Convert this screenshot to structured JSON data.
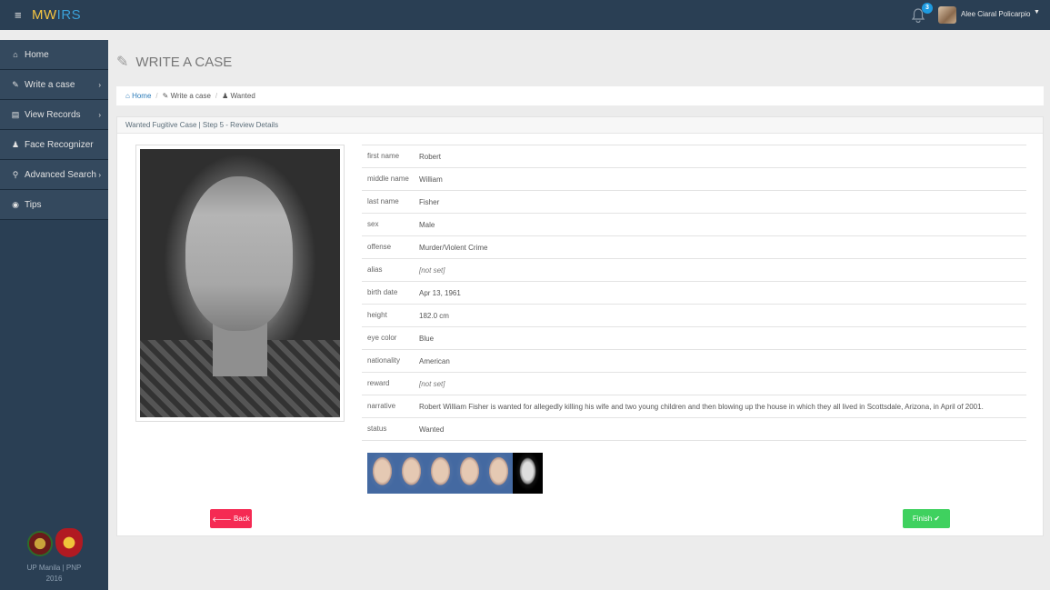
{
  "app": {
    "brand_part1": "MW",
    "brand_part2": "IRS",
    "menu_icon": "menu-icon"
  },
  "topbar": {
    "notifications_count": "3",
    "user_name": "Alee Ciaral Policarpio",
    "caret": "▼"
  },
  "sidebar": {
    "items": [
      {
        "label": "Home",
        "icon": "home-icon",
        "glyph": "⌂",
        "has_chevron": false
      },
      {
        "label": "Write a case",
        "icon": "edit-icon",
        "glyph": "✎",
        "has_chevron": true
      },
      {
        "label": "View Records",
        "icon": "list-icon",
        "glyph": "▤",
        "has_chevron": true
      },
      {
        "label": "Face Recognizer",
        "icon": "user-icon",
        "glyph": "♟",
        "has_chevron": false
      },
      {
        "label": "Advanced Search",
        "icon": "search-icon",
        "glyph": "⚲",
        "has_chevron": true
      },
      {
        "label": "Tips",
        "icon": "eye-icon",
        "glyph": "◉",
        "has_chevron": false
      }
    ],
    "footer_line1": "UP Manila | PNP",
    "footer_line2": "2016"
  },
  "page": {
    "title": "WRITE A CASE"
  },
  "breadcrumb": {
    "home": "Home",
    "write": "Write a case",
    "current": "Wanted"
  },
  "panel": {
    "heading": "Wanted Fugitive Case | Step 5 - Review Details"
  },
  "details": [
    {
      "key": "first name",
      "value": "Robert"
    },
    {
      "key": "middle name",
      "value": "William"
    },
    {
      "key": "last name",
      "value": "Fisher"
    },
    {
      "key": "sex",
      "value": "Male"
    },
    {
      "key": "offense",
      "value": "Murder/Violent Crime"
    },
    {
      "key": "alias",
      "value": "[not set]",
      "not_set": true
    },
    {
      "key": "birth date",
      "value": "Apr 13, 1961"
    },
    {
      "key": "height",
      "value": "182.0 cm"
    },
    {
      "key": "eye color",
      "value": "Blue"
    },
    {
      "key": "nationality",
      "value": "American"
    },
    {
      "key": "reward",
      "value": "[not set]",
      "not_set": true
    },
    {
      "key": "narrative",
      "value": "Robert William Fisher is wanted for allegedly killing his wife and two young children and then blowing up the house in which they all lived in Scottsdale, Arizona, in April of 2001."
    },
    {
      "key": "status",
      "value": "Wanted"
    }
  ],
  "buttons": {
    "back": "Back",
    "finish": "Finish"
  },
  "colors": {
    "sidebar": "#2a3f54",
    "back_button": "#f52a53",
    "finish_button": "#3fd15f",
    "link": "#2a7ab8"
  }
}
